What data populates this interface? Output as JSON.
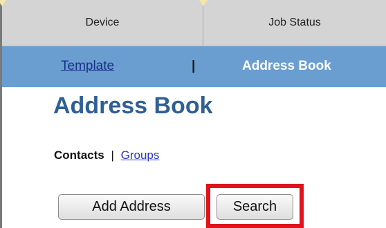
{
  "tabs": [
    {
      "label": "Device"
    },
    {
      "label": "Job Status"
    }
  ],
  "subnav": {
    "template_link": "Template",
    "separator": "|",
    "current": "Address Book"
  },
  "page_title": "Address Book",
  "contacts_row": {
    "contacts_label": "Contacts",
    "separator": "|",
    "groups_link": "Groups"
  },
  "buttons": {
    "add_address": "Add Address",
    "search": "Search"
  },
  "colors": {
    "tab_background": "#d4d4d4",
    "subnav_background": "#6b9ed0",
    "title_color": "#2f5f94",
    "highlight_color": "#e0121b",
    "link_color": "#2a33c8"
  }
}
